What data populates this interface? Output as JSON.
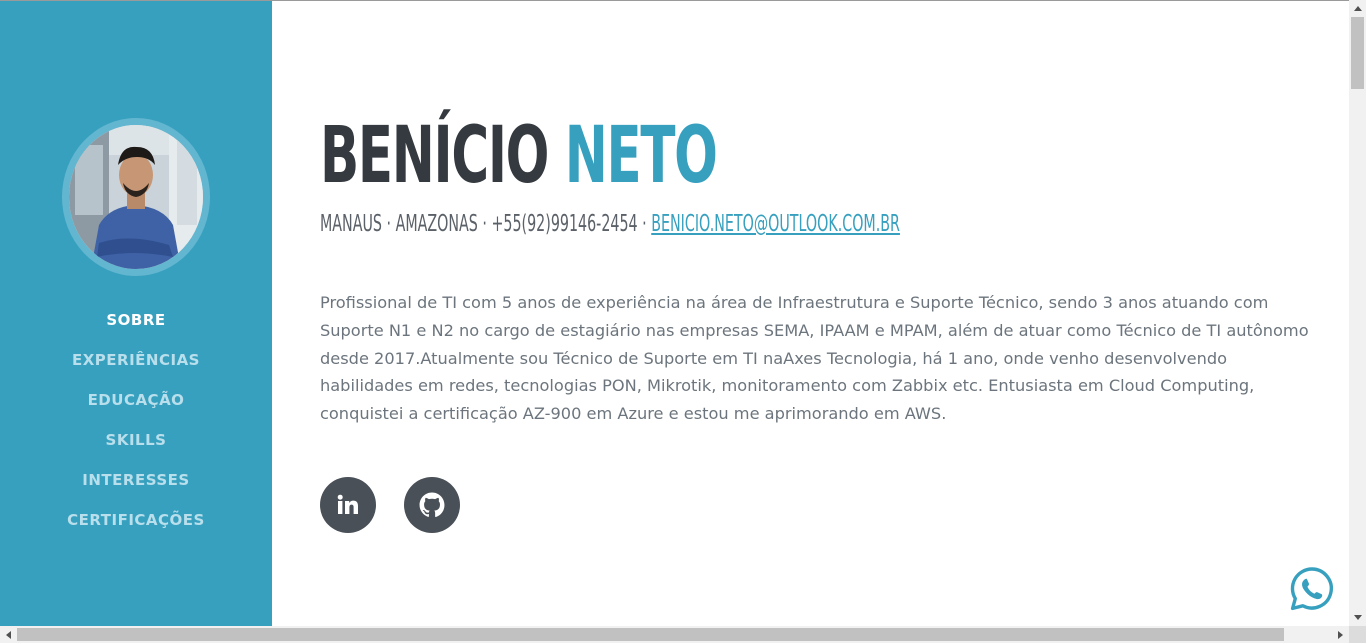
{
  "sidebar": {
    "nav": [
      {
        "label": "Sobre",
        "active": true
      },
      {
        "label": "Experiências",
        "active": false
      },
      {
        "label": "Educação",
        "active": false
      },
      {
        "label": "Skills",
        "active": false
      },
      {
        "label": "Interesses",
        "active": false
      },
      {
        "label": "Certificações",
        "active": false
      }
    ]
  },
  "profile": {
    "first_name": "Benício",
    "last_name": "Neto",
    "location": "Manaus · Amazonas · +55(92)99146-2454 · ",
    "email": "benicio.neto@outlook.com.br",
    "bio": "Profissional de TI com 5 anos de experiência na área de Infraestrutura e Suporte Técnico, sendo 3 anos atuando com Suporte N1 e N2 no cargo de estagiário nas empresas SEMA, IPAAM e MPAM, além de atuar como Técnico de TI autônomo desde 2017.Atualmente sou Técnico de Suporte em TI naAxes Tecnologia, há 1 ano, onde venho desenvolvendo habilidades em redes, tecnologias PON, Mikrotik, monitoramento com Zabbix etc. Entusiasta em Cloud Computing, conquistei a certificação AZ-900 em Azure e estou me aprimorando em AWS."
  },
  "socials": [
    {
      "icon": "linkedin-icon"
    },
    {
      "icon": "github-icon"
    }
  ],
  "floating": {
    "icon": "whatsapp-icon"
  },
  "colors": {
    "primary": "#37a0bf",
    "dark": "#343a40",
    "text": "#6c757d",
    "nav_inactive": "#b8dfeb",
    "whatsapp": "#37a0bf"
  }
}
